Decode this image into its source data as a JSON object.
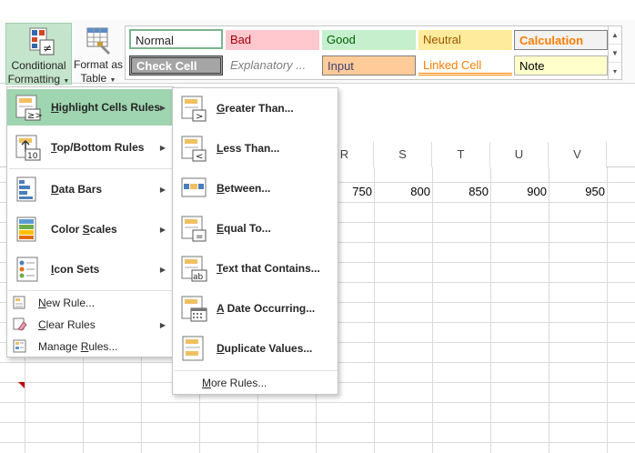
{
  "ribbon": {
    "conditional_formatting": {
      "line1": "Conditional",
      "line2": "Formatting"
    },
    "format_as_table": {
      "line1": "Format as",
      "line2": "Table"
    },
    "styles": [
      {
        "label": "Normal",
        "bg": "#ffffff",
        "fg": "#000000",
        "border": "#7bb58f"
      },
      {
        "label": "Bad",
        "bg": "#ffc7ce",
        "fg": "#9c0006"
      },
      {
        "label": "Good",
        "bg": "#c6efce",
        "fg": "#006100"
      },
      {
        "label": "Neutral",
        "bg": "#ffeb9c",
        "fg": "#9c5700"
      },
      {
        "label": "Calculation",
        "bg": "#f2f2f2",
        "fg": "#fa7d00"
      },
      {
        "label": "Check Cell",
        "bg": "#a5a5a5",
        "fg": "#ffffff"
      },
      {
        "label": "Explanatory ...",
        "bg": "#ffffff",
        "fg": "#7f7f7f"
      },
      {
        "label": "Input",
        "bg": "#ffcc99",
        "fg": "#3f3f76"
      },
      {
        "label": "Linked Cell",
        "bg": "#ffffff",
        "fg": "#fa7d00"
      },
      {
        "label": "Note",
        "bg": "#ffffcc",
        "fg": "#000000"
      }
    ]
  },
  "sheet": {
    "columns": [
      "R",
      "S",
      "T",
      "U",
      "V"
    ],
    "row_values": [
      "750",
      "800",
      "850",
      "900",
      "950"
    ]
  },
  "menu": {
    "items": [
      {
        "pre": "",
        "u": "H",
        "post": "ighlight Cells Rules"
      },
      {
        "pre": "",
        "u": "T",
        "post": "op/Bottom Rules"
      },
      {
        "pre": "",
        "u": "D",
        "post": "ata Bars"
      },
      {
        "pre": "Color ",
        "u": "S",
        "post": "cales"
      },
      {
        "pre": "",
        "u": "I",
        "post": "con Sets"
      }
    ],
    "small_items": [
      {
        "pre": "",
        "u": "N",
        "post": "ew Rule..."
      },
      {
        "pre": "",
        "u": "C",
        "post": "lear Rules"
      },
      {
        "pre": "Manage ",
        "u": "R",
        "post": "ules..."
      }
    ]
  },
  "submenu": {
    "items": [
      {
        "pre": "",
        "u": "G",
        "post": "reater Than..."
      },
      {
        "pre": "",
        "u": "L",
        "post": "ess Than..."
      },
      {
        "pre": "",
        "u": "B",
        "post": "etween..."
      },
      {
        "pre": "",
        "u": "E",
        "post": "qual To..."
      },
      {
        "pre": "",
        "u": "T",
        "post": "ext that Contains..."
      },
      {
        "pre": "",
        "u": "A",
        "post": " Date Occurring..."
      },
      {
        "pre": "",
        "u": "D",
        "post": "uplicate Values..."
      }
    ],
    "more": {
      "pre": "",
      "u": "M",
      "post": "ore Rules..."
    }
  }
}
